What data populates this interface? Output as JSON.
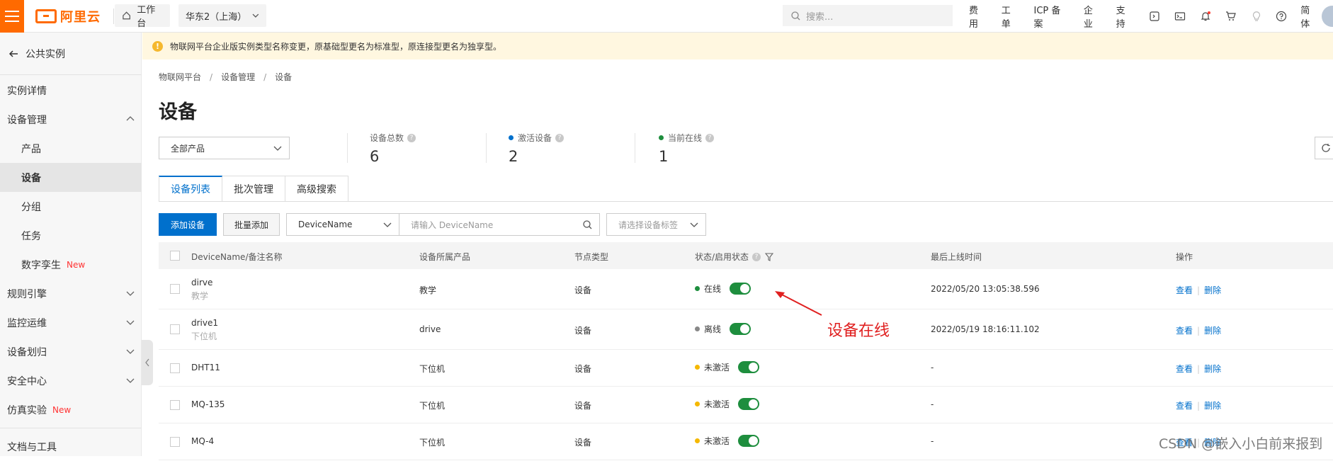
{
  "topbar": {
    "logo_text": "阿里云",
    "workbench": "工作台",
    "region": "华东2（上海）",
    "search_placeholder": "搜索...",
    "nav": [
      "费用",
      "工单",
      "ICP 备案",
      "企业",
      "支持"
    ],
    "lang": "简体"
  },
  "sidebar": {
    "back_label": "公共实例",
    "items": [
      {
        "label": "实例详情"
      },
      {
        "label": "设备管理"
      },
      {
        "label": "产品"
      },
      {
        "label": "设备"
      },
      {
        "label": "分组"
      },
      {
        "label": "任务"
      },
      {
        "label": "数字孪生",
        "badge": "New"
      },
      {
        "label": "规则引擎"
      },
      {
        "label": "监控运维"
      },
      {
        "label": "设备划归"
      },
      {
        "label": "安全中心"
      },
      {
        "label": "仿真实验",
        "badge": "New"
      },
      {
        "label": "文档与工具"
      }
    ]
  },
  "notice": "物联网平台企业版实例类型名称变更，原基础型更名为标准型，原连接型更名为独享型。",
  "breadcrumb": [
    "物联网平台",
    "设备管理",
    "设备"
  ],
  "page_title": "设备",
  "product_select": "全部产品",
  "stats": [
    {
      "label": "设备总数",
      "value": "6"
    },
    {
      "label": "激活设备",
      "value": "2",
      "dot_color": "#0070cc"
    },
    {
      "label": "当前在线",
      "value": "1",
      "dot_color": "#1e8e3e"
    }
  ],
  "tabs": [
    "设备列表",
    "批次管理",
    "高级搜索"
  ],
  "toolbar": {
    "add_device": "添加设备",
    "batch_add": "批量添加",
    "filter_field": "DeviceName",
    "filter_placeholder": "请输入 DeviceName",
    "tag_placeholder": "请选择设备标签"
  },
  "table": {
    "headers": [
      "DeviceName/备注名称",
      "设备所属产品",
      "节点类型",
      "状态/启用状态",
      "最后上线时间",
      "操作"
    ],
    "rows": [
      {
        "name": "dirve",
        "note": "教学",
        "product": "教学",
        "node": "设备",
        "status": "在线",
        "status_color": "#1e8e3e",
        "enabled": true,
        "last_online": "2022/05/20 13:05:38.596"
      },
      {
        "name": "drive1",
        "note": "下位机",
        "product": "drive",
        "node": "设备",
        "status": "离线",
        "status_color": "#888888",
        "enabled": true,
        "last_online": "2022/05/19 18:16:11.102"
      },
      {
        "name": "DHT11",
        "note": "",
        "product": "下位机",
        "node": "设备",
        "status": "未激活",
        "status_color": "#f5b800",
        "enabled": true,
        "last_online": "-"
      },
      {
        "name": "MQ-135",
        "note": "",
        "product": "下位机",
        "node": "设备",
        "status": "未激活",
        "status_color": "#f5b800",
        "enabled": true,
        "last_online": "-"
      },
      {
        "name": "MQ-4",
        "note": "",
        "product": "下位机",
        "node": "设备",
        "status": "未激活",
        "status_color": "#f5b800",
        "enabled": true,
        "last_online": "-"
      }
    ],
    "action_view": "查看",
    "action_delete": "删除"
  },
  "annotation": "设备在线",
  "watermark": "CSDN @嵌入小白前来报到",
  "colors": {
    "brand": "#ff6a00",
    "primary": "#0070cc",
    "online": "#1e8e3e",
    "annotation": "#e02020"
  }
}
